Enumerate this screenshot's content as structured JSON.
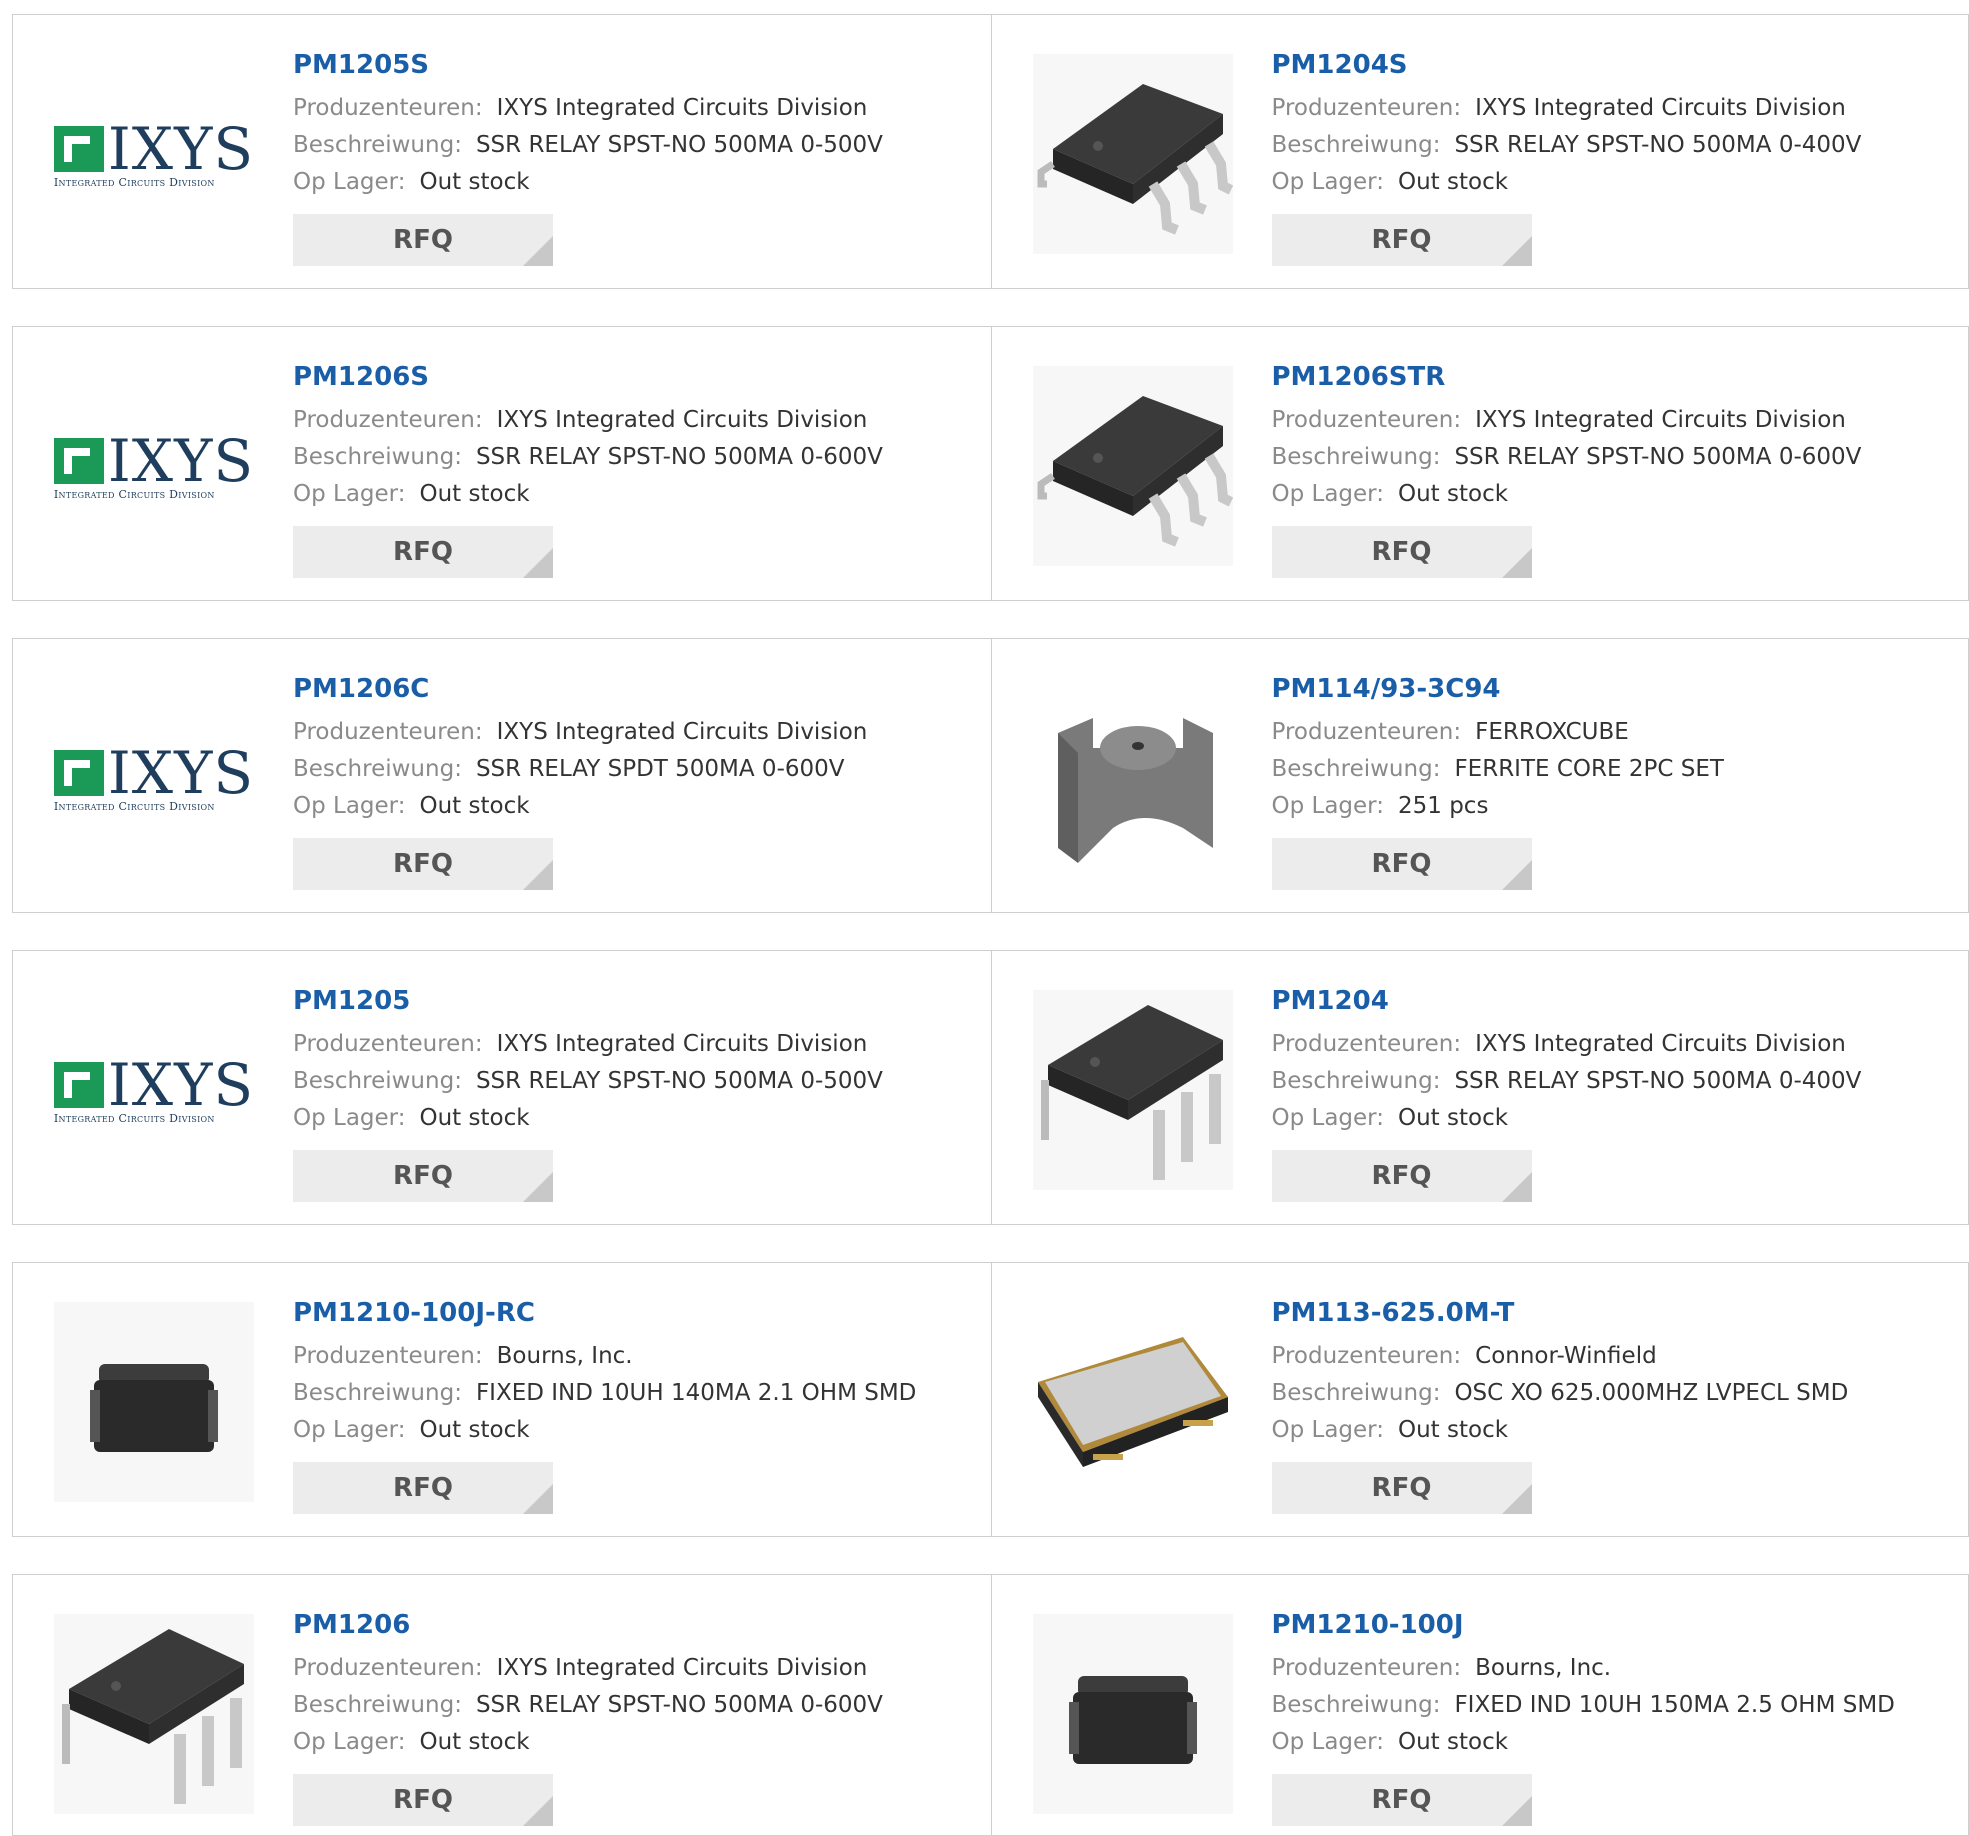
{
  "labels": {
    "manufacturer": "Produzenteuren:",
    "description": "Beschreiwung:",
    "stock": "Op Lager:",
    "rfq": "RFQ"
  },
  "logo": {
    "word": "IXYS",
    "sub": "Integrated Circuits Division"
  },
  "products": [
    {
      "part": "PM1205S",
      "manufacturer": "IXYS Integrated Circuits Division",
      "description": "SSR RELAY SPST-NO 500MA 0-500V",
      "stock": "Out stock",
      "image": "ixys-logo"
    },
    {
      "part": "PM1204S",
      "manufacturer": "IXYS Integrated Circuits Division",
      "description": "SSR RELAY SPST-NO 500MA 0-400V",
      "stock": "Out stock",
      "image": "smd-dip-chip-icon"
    },
    {
      "part": "PM1206S",
      "manufacturer": "IXYS Integrated Circuits Division",
      "description": "SSR RELAY SPST-NO 500MA 0-600V",
      "stock": "Out stock",
      "image": "ixys-logo"
    },
    {
      "part": "PM1206STR",
      "manufacturer": "IXYS Integrated Circuits Division",
      "description": "SSR RELAY SPST-NO 500MA 0-600V",
      "stock": "Out stock",
      "image": "smd-dip-chip-icon"
    },
    {
      "part": "PM1206C",
      "manufacturer": "IXYS Integrated Circuits Division",
      "description": "SSR RELAY SPDT 500MA 0-600V",
      "stock": "Out stock",
      "image": "ixys-logo"
    },
    {
      "part": "PM114/93-3C94",
      "manufacturer": "FERROXCUBE",
      "description": "FERRITE CORE 2PC SET",
      "stock": "251 pcs",
      "image": "ferrite-core-icon"
    },
    {
      "part": "PM1205",
      "manufacturer": "IXYS Integrated Circuits Division",
      "description": "SSR RELAY SPST-NO 500MA 0-500V",
      "stock": "Out stock",
      "image": "ixys-logo"
    },
    {
      "part": "PM1204",
      "manufacturer": "IXYS Integrated Circuits Division",
      "description": "SSR RELAY SPST-NO 500MA 0-400V",
      "stock": "Out stock",
      "image": "dip-chip-icon"
    },
    {
      "part": "PM1210-100J-RC",
      "manufacturer": "Bourns, Inc.",
      "description": "FIXED IND 10UH 140MA 2.1 OHM SMD",
      "stock": "Out stock",
      "image": "smd-inductor-icon"
    },
    {
      "part": "PM113-625.0M-T",
      "manufacturer": "Connor-Winfield",
      "description": "OSC XO 625.000MHZ LVPECL SMD",
      "stock": "Out stock",
      "image": "oscillator-icon"
    },
    {
      "part": "PM1206",
      "manufacturer": "IXYS Integrated Circuits Division",
      "description": "SSR RELAY SPST-NO 500MA 0-600V",
      "stock": "Out stock",
      "image": "dip-chip-icon"
    },
    {
      "part": "PM1210-100J",
      "manufacturer": "Bourns, Inc.",
      "description": "FIXED IND 10UH 150MA 2.5 OHM SMD",
      "stock": "Out stock",
      "image": "smd-inductor-icon"
    }
  ]
}
